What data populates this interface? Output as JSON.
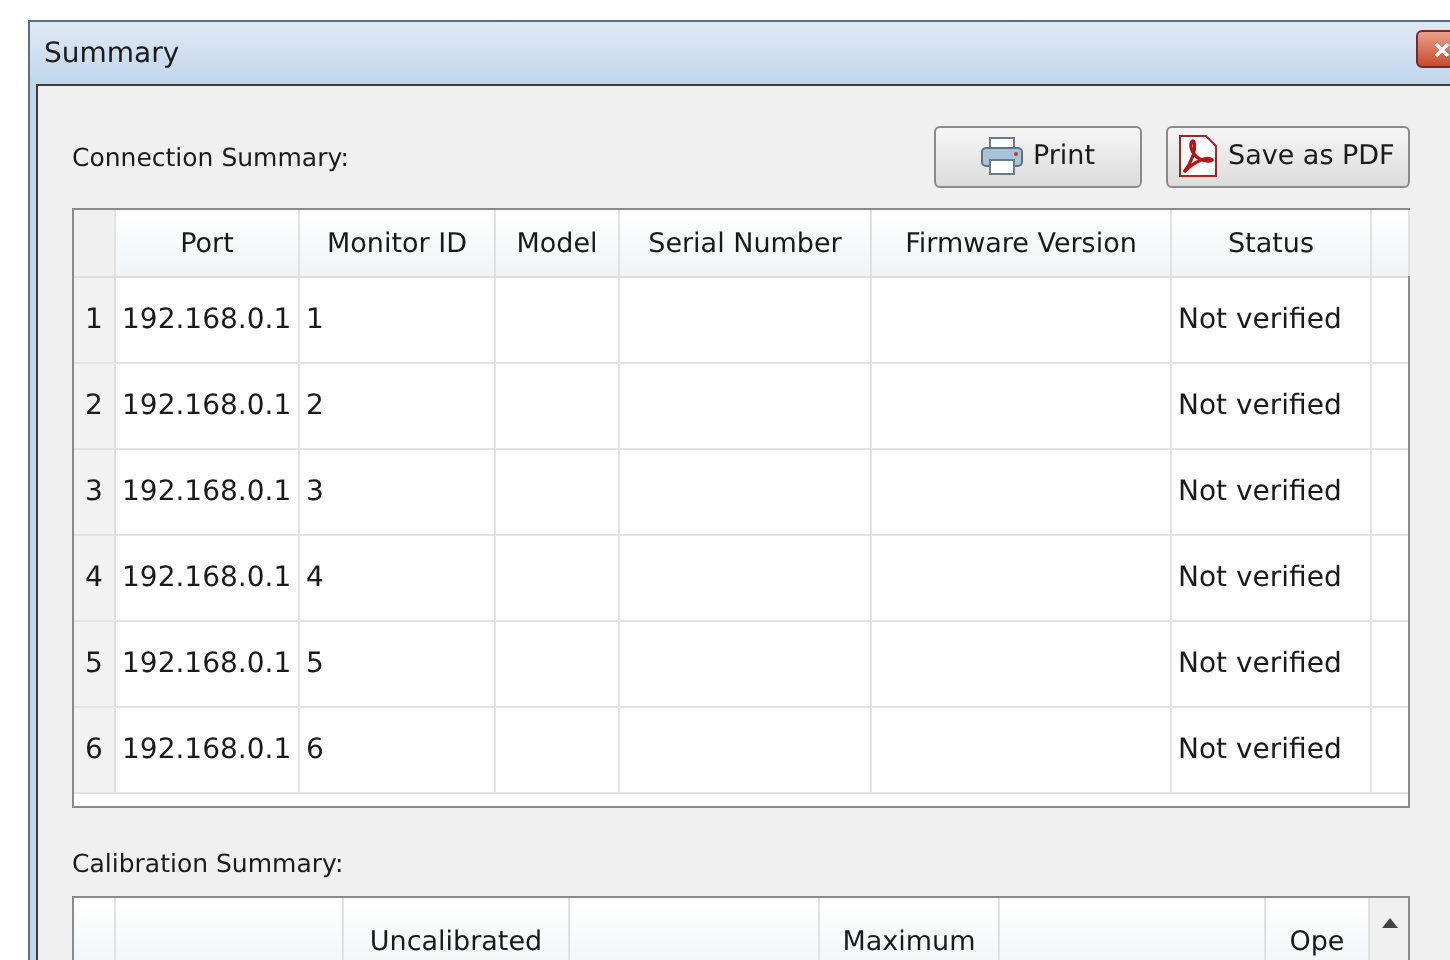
{
  "window": {
    "title": "Summary"
  },
  "connection_summary": {
    "label": "Connection Summary:",
    "buttons": [
      {
        "kind": "print",
        "label": "Print"
      },
      {
        "kind": "pdf",
        "label": "Save as PDF"
      }
    ],
    "columns": [
      "Port",
      "Monitor ID",
      "Model",
      "Serial Number",
      "Firmware Version",
      "Status"
    ],
    "rows": [
      {
        "number": "1",
        "port": "192.168.0.1",
        "monitor_id": "1",
        "status": "Not verified"
      },
      {
        "number": "2",
        "port": "192.168.0.1",
        "monitor_id": "2",
        "status": "Not verified"
      },
      {
        "number": "3",
        "port": "192.168.0.1",
        "monitor_id": "3",
        "status": "Not verified"
      },
      {
        "number": "4",
        "port": "192.168.0.1",
        "monitor_id": "4",
        "status": "Not verified"
      },
      {
        "number": "5",
        "port": "192.168.0.1",
        "monitor_id": "5",
        "status": "Not verified"
      },
      {
        "number": "6",
        "port": "192.168.0.1",
        "monitor_id": "6",
        "status": "Not verified"
      }
    ]
  },
  "calibration_summary": {
    "label": "Calibration Summary:",
    "columns": [
      "Uncalibrated",
      "Maximum",
      "Ope"
    ]
  }
}
